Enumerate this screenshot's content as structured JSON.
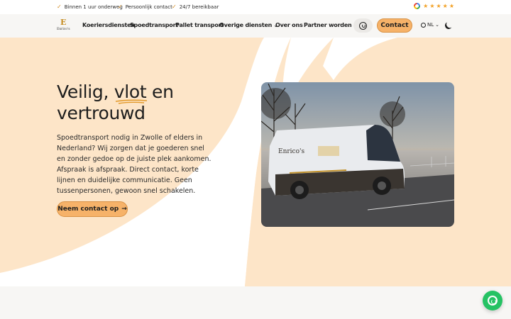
{
  "topbar": {
    "usps": [
      {
        "icon": "check-icon",
        "text": "Binnen 1 uur onderweg"
      },
      {
        "icon": "check-icon",
        "text": "Persoonlijk contact"
      },
      {
        "icon": "check-icon",
        "text": "24/7 bereikbaar"
      }
    ],
    "rating": {
      "icon": "google-icon",
      "stars": 5
    }
  },
  "header": {
    "logo_text": "Enrico's",
    "logo_mark": "E",
    "nav": [
      {
        "label": "Koeriersdiensten"
      },
      {
        "label": "Spoedtransport"
      },
      {
        "label": "Pallet transport"
      },
      {
        "label": "Overige diensten",
        "has_dropdown": true
      },
      {
        "label": "Over ons"
      },
      {
        "label": "Partner worden"
      }
    ],
    "whatsapp_icon": "whatsapp-icon",
    "contact_label": "Contact",
    "language": "NL",
    "theme_icon": "moon-icon"
  },
  "hero": {
    "title_line1_a": "Veilig, ",
    "title_highlight": "vlot",
    "title_line1_b": " en",
    "title_line2": "vertrouwd",
    "lead": "Spoedtransport nodig in Zwolle of elders in Nederland? Wij zorgen dat je goederen snel en zonder gedoe op de juiste plek aankomen. Afspraak is afspraak. Direct contact, korte lijnen en duidelijke communicatie. Geen tussenpersonen, gewoon snel schakelen.",
    "cta_label": "Neem contact op",
    "cta_arrow": "→",
    "image_alt": "Bestelbus van Enrico's in een winters landschap",
    "van_logo_text": "Enrico's"
  },
  "floating": {
    "whatsapp_icon": "whatsapp-icon"
  },
  "colors": {
    "accent": "#f6b269",
    "hero_bg": "#fde5c8",
    "check": "#d28a1f",
    "whatsapp": "#25c263"
  }
}
